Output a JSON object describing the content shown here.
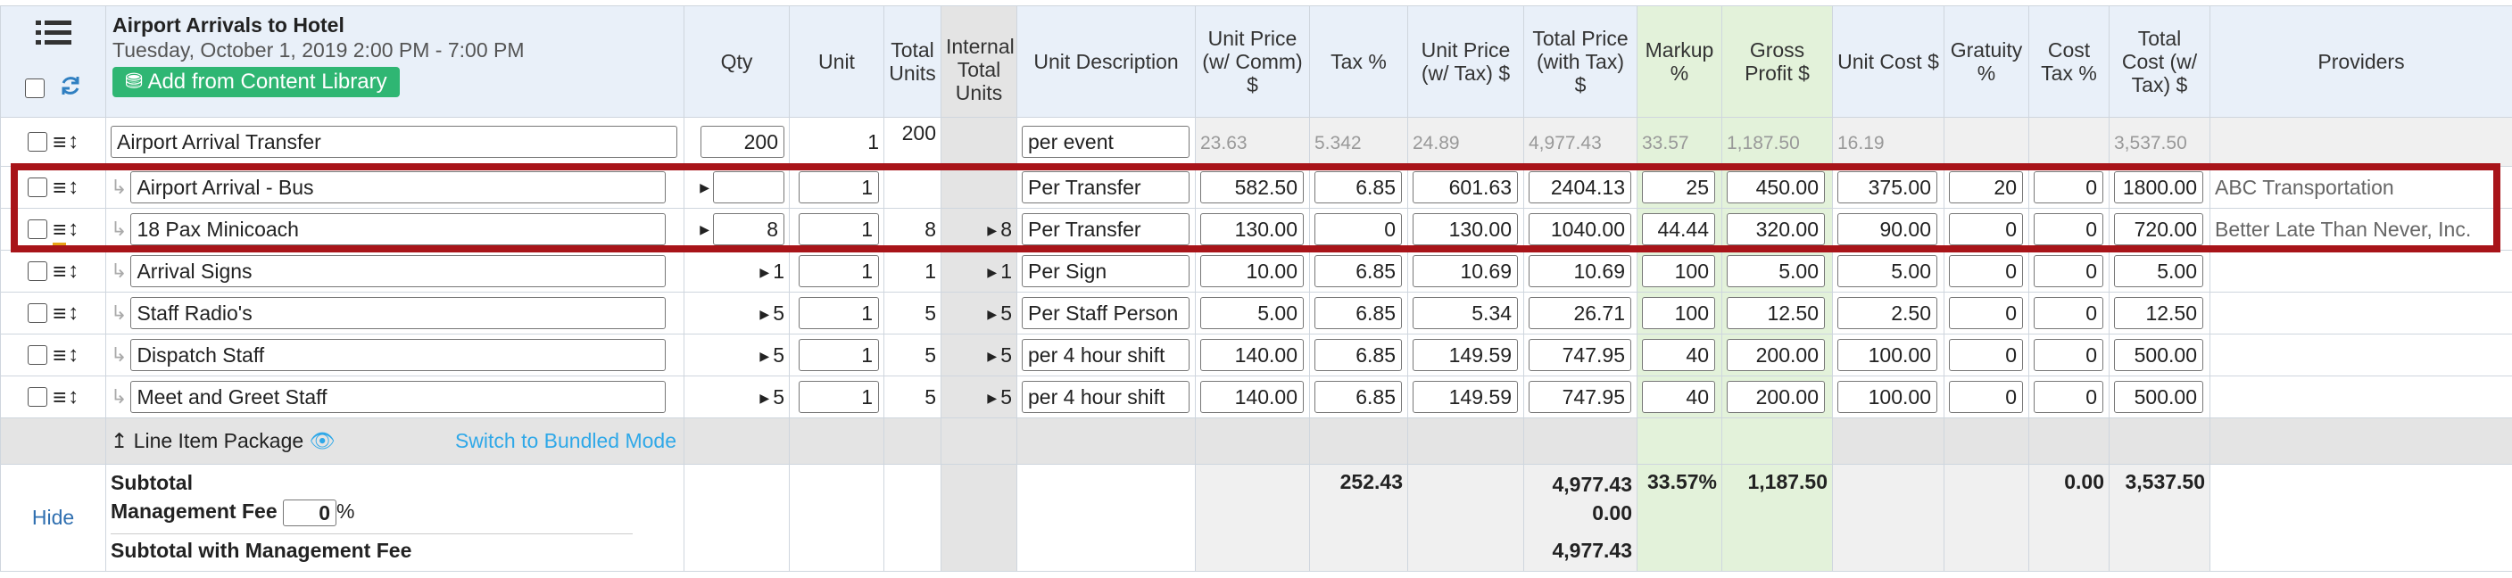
{
  "header": {
    "title": "Airport Arrivals to Hotel",
    "subtitle": "Tuesday, October 1, 2019 2:00 PM - 7:00 PM",
    "add_button": "Add from Content Library",
    "columns": {
      "qty": "Qty",
      "unit": "Unit",
      "total_units": "Total Units",
      "internal_total_units": "Internal Total Units",
      "unit_description": "Unit Description",
      "unit_price_comm": "Unit Price (w/ Comm) $",
      "tax": "Tax %",
      "unit_price_tax": "Unit Price (w/ Tax) $",
      "total_price_tax": "Total Price (with Tax) $",
      "markup": "Markup %",
      "gross_profit": "Gross Profit $",
      "unit_cost": "Unit Cost $",
      "gratuity": "Gratuity %",
      "cost_tax": "Cost Tax %",
      "total_cost_tax": "Total Cost (w/ Tax) $",
      "providers": "Providers"
    }
  },
  "rows": {
    "r0": {
      "name": "Airport Arrival Transfer",
      "qty": "200",
      "unit": "1",
      "total_units": "200",
      "internal": "",
      "desc": "per event",
      "unit_price": "23.63",
      "tax": "5.342",
      "unit_price_tax": "24.89",
      "total_price": "4,977.43",
      "markup": "33.57",
      "gross_profit": "1,187.50",
      "unit_cost": "16.19",
      "gratuity": "",
      "cost_tax": "",
      "total_cost": "3,537.50",
      "provider": ""
    },
    "r1": {
      "name": "Airport Arrival - Bus",
      "qty": "",
      "unit": "1",
      "total_units": "",
      "internal": "",
      "desc": "Per Transfer",
      "unit_price": "582.50",
      "tax": "6.85",
      "unit_price_tax": "601.63",
      "total_price": "2404.13",
      "markup": "25",
      "gross_profit": "450.00",
      "unit_cost": "375.00",
      "gratuity": "20",
      "cost_tax": "0",
      "total_cost": "1800.00",
      "provider": "ABC Transportation"
    },
    "r2": {
      "name": "18 Pax Minicoach",
      "qty": "8",
      "unit": "1",
      "total_units": "8",
      "internal": "8",
      "desc": "Per Transfer",
      "unit_price": "130.00",
      "tax": "0",
      "unit_price_tax": "130.00",
      "total_price": "1040.00",
      "markup": "44.44",
      "gross_profit": "320.00",
      "unit_cost": "90.00",
      "gratuity": "0",
      "cost_tax": "0",
      "total_cost": "720.00",
      "provider": "Better Late Than Never, Inc."
    },
    "r3": {
      "name": "Arrival Signs",
      "qty": "1",
      "unit": "1",
      "total_units": "1",
      "internal": "1",
      "desc": "Per Sign",
      "unit_price": "10.00",
      "tax": "6.85",
      "unit_price_tax": "10.69",
      "total_price": "10.69",
      "markup": "100",
      "gross_profit": "5.00",
      "unit_cost": "5.00",
      "gratuity": "0",
      "cost_tax": "0",
      "total_cost": "5.00",
      "provider": ""
    },
    "r4": {
      "name": "Staff Radio's",
      "qty": "5",
      "unit": "1",
      "total_units": "5",
      "internal": "5",
      "desc": "Per Staff Person",
      "unit_price": "5.00",
      "tax": "6.85",
      "unit_price_tax": "5.34",
      "total_price": "26.71",
      "markup": "100",
      "gross_profit": "12.50",
      "unit_cost": "2.50",
      "gratuity": "0",
      "cost_tax": "0",
      "total_cost": "12.50",
      "provider": ""
    },
    "r5": {
      "name": "Dispatch Staff",
      "qty": "5",
      "unit": "1",
      "total_units": "5",
      "internal": "5",
      "desc": "per 4 hour shift",
      "unit_price": "140.00",
      "tax": "6.85",
      "unit_price_tax": "149.59",
      "total_price": "747.95",
      "markup": "40",
      "gross_profit": "200.00",
      "unit_cost": "100.00",
      "gratuity": "0",
      "cost_tax": "0",
      "total_cost": "500.00",
      "provider": ""
    },
    "r6": {
      "name": "Meet and Greet Staff",
      "qty": "5",
      "unit": "1",
      "total_units": "5",
      "internal": "5",
      "desc": "per 4 hour shift",
      "unit_price": "140.00",
      "tax": "6.85",
      "unit_price_tax": "149.59",
      "total_price": "747.95",
      "markup": "40",
      "gross_profit": "200.00",
      "unit_cost": "100.00",
      "gratuity": "0",
      "cost_tax": "0",
      "total_cost": "500.00",
      "provider": ""
    }
  },
  "package_row": {
    "label": "Line Item Package",
    "switch_link": "Switch to Bundled Mode"
  },
  "summary": {
    "hide": "Hide",
    "subtotal_label": "Subtotal",
    "mgmt_fee_label": "Management Fee",
    "mgmt_fee_value": "0",
    "mgmt_fee_unit": "%",
    "subtotal_mgmt_label": "Subtotal with Management Fee",
    "tax_total": "252.43",
    "total_price": "4,977.43",
    "mgmt_fee_amount": "0.00",
    "subtotal_mgmt_total": "4,977.43",
    "markup": "33.57%",
    "gross_profit": "1,187.50",
    "cost_tax": "0.00",
    "total_cost": "3,537.50"
  },
  "colors": {
    "accent_green": "#2fb673",
    "highlight_red": "#a81419",
    "link_blue": "#2fa8e8"
  },
  "icons": [
    "list-icon",
    "refresh-icon",
    "database-icon",
    "hamburger-icon",
    "updown-arrows-icon",
    "sub-item-arrow-icon",
    "expand-triangle-icon",
    "upload-arrow-icon",
    "eye-icon"
  ]
}
